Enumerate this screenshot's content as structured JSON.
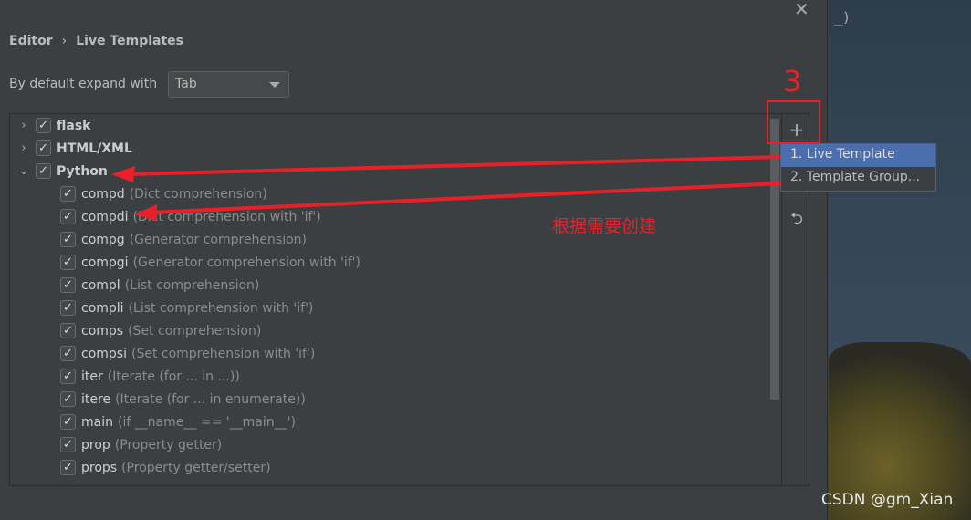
{
  "breadcrumb": {
    "parent": "Editor",
    "separator": "›",
    "current": "Live Templates"
  },
  "expand": {
    "label": "By default expand with",
    "value": "Tab"
  },
  "tree": [
    {
      "type": "group",
      "name": "flask",
      "expanded": false,
      "checked": true
    },
    {
      "type": "group",
      "name": "HTML/XML",
      "expanded": false,
      "checked": true
    },
    {
      "type": "group",
      "name": "Python",
      "expanded": true,
      "checked": true
    },
    {
      "type": "item",
      "abbr": "compd",
      "desc": "(Dict comprehension)",
      "checked": true
    },
    {
      "type": "item",
      "abbr": "compdi",
      "desc": "(Dict comprehension with 'if')",
      "checked": true
    },
    {
      "type": "item",
      "abbr": "compg",
      "desc": "(Generator comprehension)",
      "checked": true
    },
    {
      "type": "item",
      "abbr": "compgi",
      "desc": "(Generator comprehension with 'if')",
      "checked": true
    },
    {
      "type": "item",
      "abbr": "compl",
      "desc": "(List comprehension)",
      "checked": true
    },
    {
      "type": "item",
      "abbr": "compli",
      "desc": "(List comprehension with 'if')",
      "checked": true
    },
    {
      "type": "item",
      "abbr": "comps",
      "desc": "(Set comprehension)",
      "checked": true
    },
    {
      "type": "item",
      "abbr": "compsi",
      "desc": "(Set comprehension with 'if')",
      "checked": true
    },
    {
      "type": "item",
      "abbr": "iter",
      "desc": "(Iterate (for ... in ...))",
      "checked": true
    },
    {
      "type": "item",
      "abbr": "itere",
      "desc": "(Iterate (for ... in enumerate))",
      "checked": true
    },
    {
      "type": "item",
      "abbr": "main",
      "desc": "(if __name__ == '__main__')",
      "checked": true
    },
    {
      "type": "item",
      "abbr": "prop",
      "desc": "(Property getter)",
      "checked": true
    },
    {
      "type": "item",
      "abbr": "props",
      "desc": "(Property getter/setter)",
      "checked": true
    }
  ],
  "toolbar": {
    "add": "+",
    "remove": "−",
    "undo": "⮌"
  },
  "menu": {
    "items": [
      "1. Live Template",
      "2. Template Group..."
    ],
    "selected": 0
  },
  "close": "✕",
  "background": {
    "code": "_)"
  },
  "annotations": {
    "step": "3",
    "note": "根据需要创建",
    "color": "#e8202a"
  },
  "watermark": "CSDN @gm_Xian"
}
